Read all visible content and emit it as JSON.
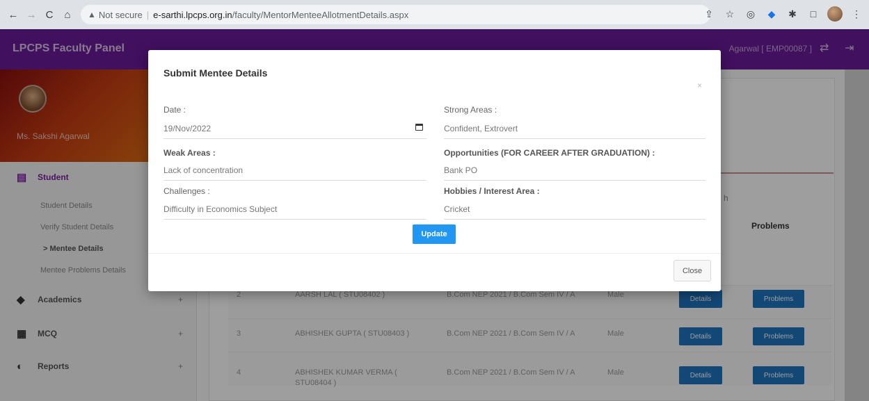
{
  "browser": {
    "not_secure": "Not secure",
    "host": "e-sarthi.lpcps.org.in",
    "path": "/faculty/MentorMenteeAllotmentDetails.aspx"
  },
  "header": {
    "brand": "LPCPS Faculty Panel",
    "user": "Agarwal [ EMP00087 ]"
  },
  "sidebar": {
    "profile_name": "Ms. Sakshi Agarwal",
    "sections": [
      {
        "label": "Student",
        "icon": "clipboard-icon"
      },
      {
        "label": "Academics",
        "icon": "graduation-cap-icon"
      },
      {
        "label": "MCQ",
        "icon": "chat-icon"
      },
      {
        "label": "Reports",
        "icon": "pie-chart-icon"
      }
    ],
    "student_items": [
      "Student Details",
      "Verify Student Details",
      "> Mentee Details",
      "Mentee Problems Details"
    ],
    "expand_symbol": "+"
  },
  "table": {
    "problems_header": "Problems",
    "rows": [
      {
        "sno": "2",
        "name": "AARSH LAL ( STU08402 )",
        "course": "B.Com NEP 2021 / B.Com Sem IV / A",
        "gender": "Male"
      },
      {
        "sno": "3",
        "name": "ABHISHEK GUPTA ( STU08403 )",
        "course": "B.Com NEP 2021 / B.Com Sem IV / A",
        "gender": "Male"
      },
      {
        "sno": "4",
        "name": "ABHISHEK KUMAR VERMA ( STU08404 )",
        "course": "B.Com NEP 2021 / B.Com Sem IV / A",
        "gender": "Male"
      }
    ],
    "details_label": "Details",
    "problems_label": "Problems"
  },
  "modal": {
    "title": "Submit Mentee Details",
    "close_x": "×",
    "date_label": "Date :",
    "date_value": "19/Nov/2022",
    "strong_label": "Strong Areas :",
    "strong_value": "Confident, Extrovert",
    "weak_label": "Weak Areas :",
    "weak_value": "Lack of concentration",
    "opportunities_label": "Opportunities (FOR CAREER AFTER GRADUATION) :",
    "opportunities_value": "Bank PO",
    "challenges_label": "Challenges :",
    "challenges_value": "Difficulty in Economics Subject",
    "hobbies_label": "Hobbies / Interest Area :",
    "hobbies_value": "Cricket",
    "update_label": "Update",
    "close_label": "Close"
  }
}
